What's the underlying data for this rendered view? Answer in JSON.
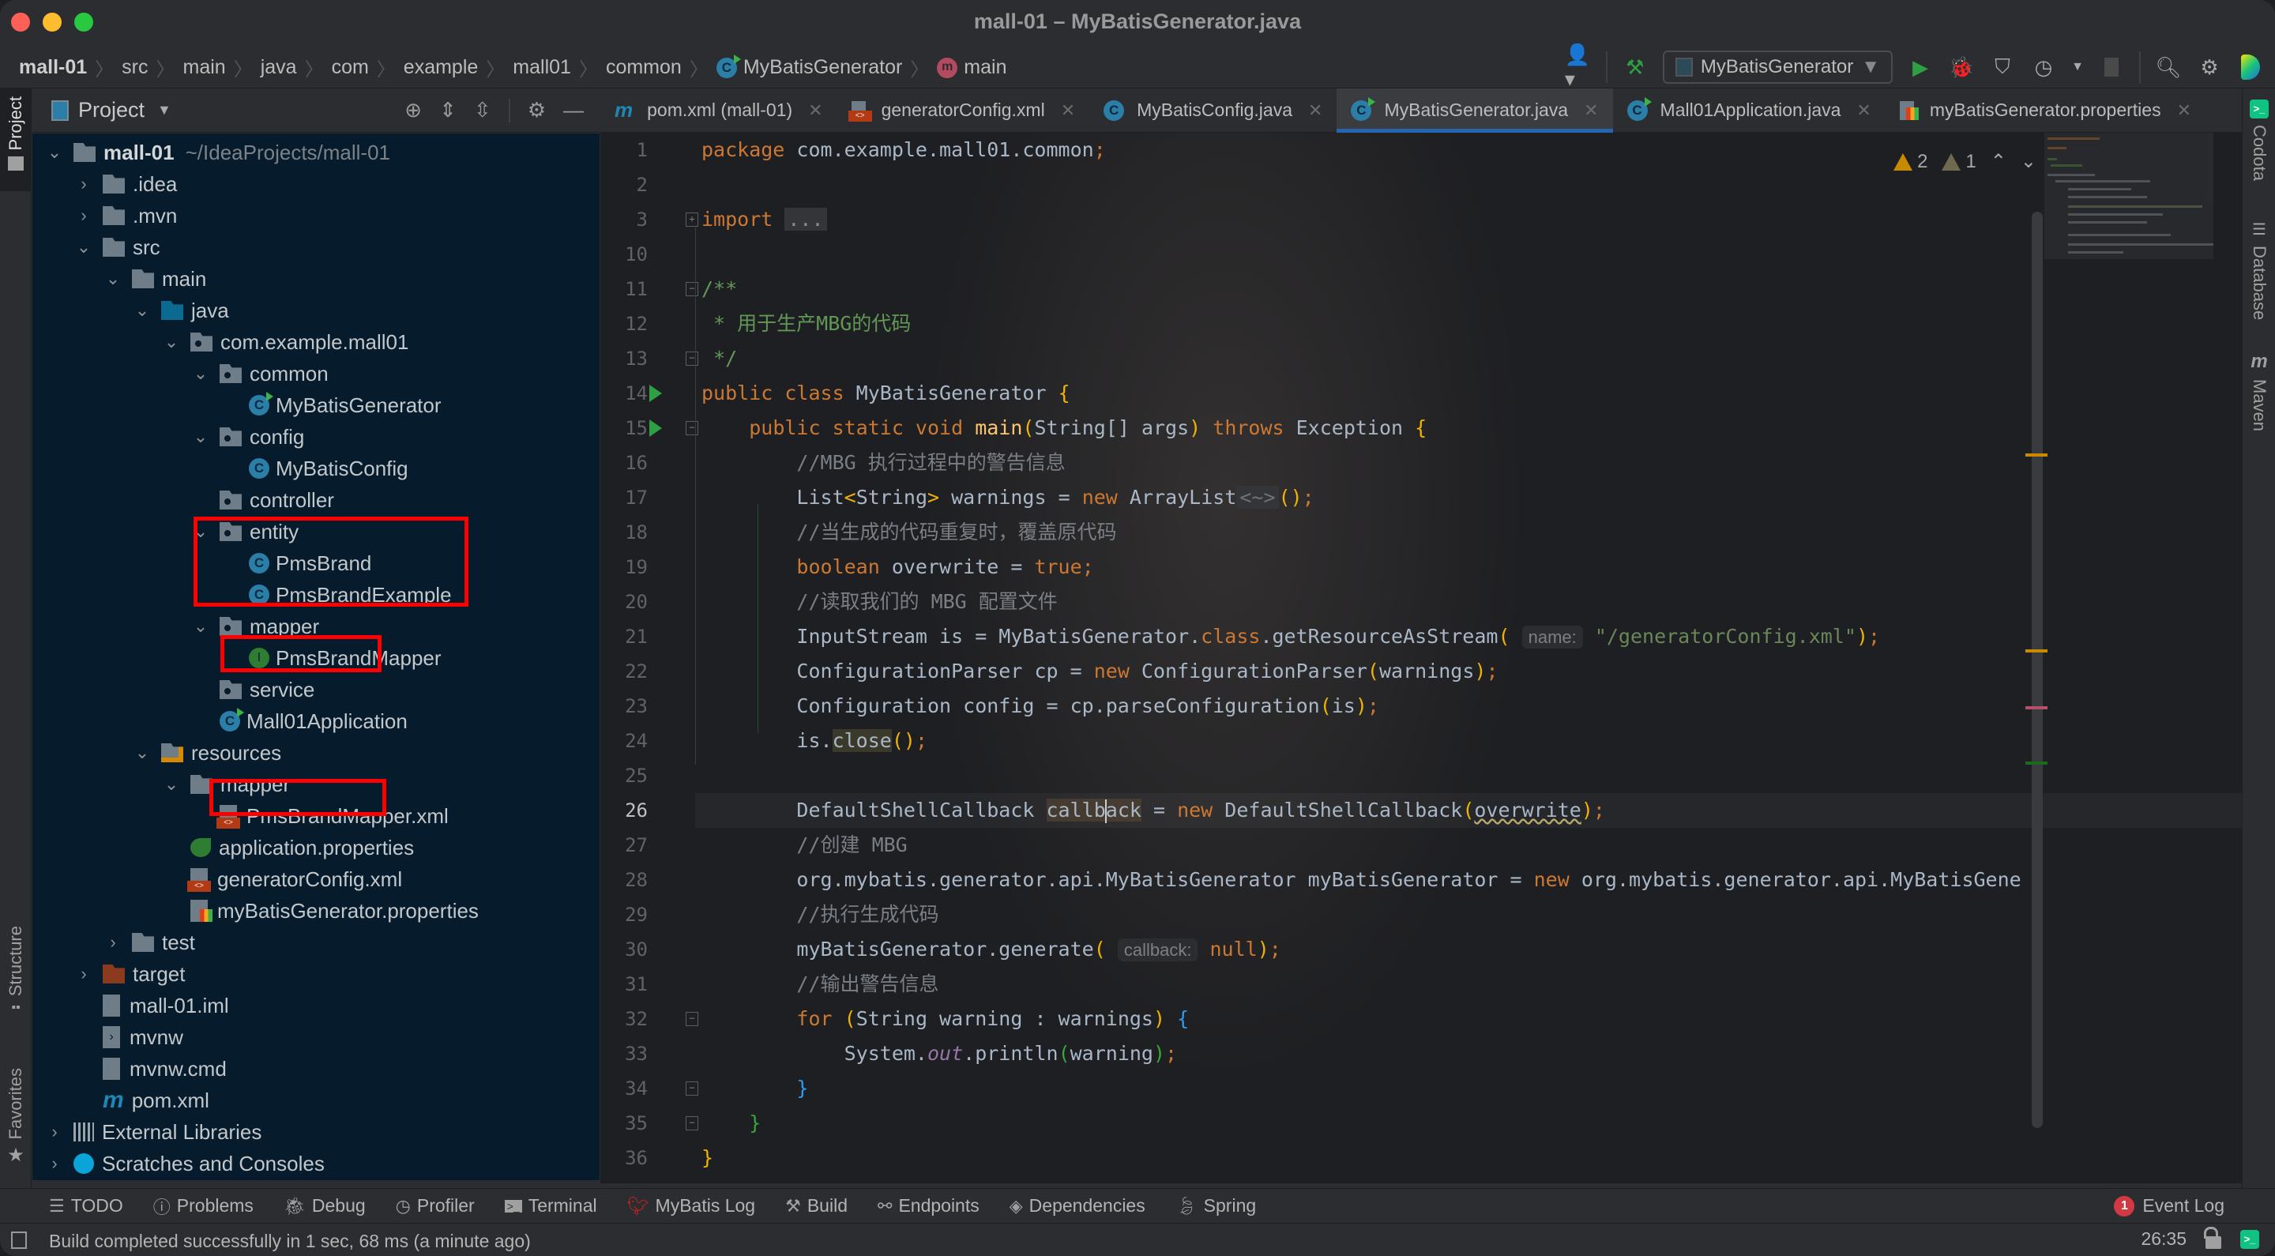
{
  "window": {
    "title": "mall-01 – MyBatisGenerator.java"
  },
  "breadcrumbs": [
    {
      "label": "mall-01",
      "icon": "none"
    },
    {
      "label": "src",
      "icon": "none"
    },
    {
      "label": "main",
      "icon": "none"
    },
    {
      "label": "java",
      "icon": "none"
    },
    {
      "label": "com",
      "icon": "none"
    },
    {
      "label": "example",
      "icon": "none"
    },
    {
      "label": "mall01",
      "icon": "none"
    },
    {
      "label": "common",
      "icon": "none"
    },
    {
      "label": "MyBatisGenerator",
      "icon": "class-icon"
    },
    {
      "label": "main",
      "icon": "method-icon"
    }
  ],
  "toolbar": {
    "run_config_label": "MyBatisGenerator",
    "icons": [
      "vcs-user-icon",
      "build-hammer-icon",
      "run-icon",
      "debug-icon",
      "coverage-icon",
      "profile-icon",
      "stop-icon",
      "search-icon",
      "settings-gear-icon",
      "jetbrains-logo-icon"
    ]
  },
  "left_stripe": {
    "project_label": "Project",
    "structure_label": "Structure",
    "favorites_label": "Favorites"
  },
  "project_panel": {
    "title": "Project",
    "tools": [
      "locate-icon",
      "expand-all-icon",
      "collapse-all-icon",
      "gear-icon",
      "hide-icon"
    ],
    "tree": [
      {
        "label": "mall-01",
        "path": "~/IdeaProjects/mall-01",
        "depth": 0,
        "state": "expanded",
        "icon": "module",
        "bold": true
      },
      {
        "label": ".idea",
        "depth": 1,
        "state": "collapsed",
        "icon": "folder"
      },
      {
        "label": ".mvn",
        "depth": 1,
        "state": "collapsed",
        "icon": "folder"
      },
      {
        "label": "src",
        "depth": 1,
        "state": "expanded",
        "icon": "folder"
      },
      {
        "label": "main",
        "depth": 2,
        "state": "expanded",
        "icon": "folder"
      },
      {
        "label": "java",
        "depth": 3,
        "state": "expanded",
        "icon": "source-folder"
      },
      {
        "label": "com.example.mall01",
        "depth": 4,
        "state": "expanded",
        "icon": "package"
      },
      {
        "label": "common",
        "depth": 5,
        "state": "expanded",
        "icon": "package"
      },
      {
        "label": "MyBatisGenerator",
        "depth": 6,
        "state": "leaf",
        "icon": "runnable-class"
      },
      {
        "label": "config",
        "depth": 5,
        "state": "expanded",
        "icon": "package"
      },
      {
        "label": "MyBatisConfig",
        "depth": 6,
        "state": "leaf",
        "icon": "class"
      },
      {
        "label": "controller",
        "depth": 5,
        "state": "leaf",
        "icon": "package"
      },
      {
        "label": "entity",
        "depth": 5,
        "state": "expanded",
        "icon": "package"
      },
      {
        "label": "PmsBrand",
        "depth": 6,
        "state": "leaf",
        "icon": "class"
      },
      {
        "label": "PmsBrandExample",
        "depth": 6,
        "state": "leaf",
        "icon": "class"
      },
      {
        "label": "mapper",
        "depth": 5,
        "state": "expanded",
        "icon": "package"
      },
      {
        "label": "PmsBrandMapper",
        "depth": 6,
        "state": "leaf",
        "icon": "interface"
      },
      {
        "label": "service",
        "depth": 5,
        "state": "leaf",
        "icon": "package"
      },
      {
        "label": "Mall01Application",
        "depth": 5,
        "state": "leaf",
        "icon": "spring-boot-class"
      },
      {
        "label": "resources",
        "depth": 3,
        "state": "expanded",
        "icon": "resources-folder"
      },
      {
        "label": "mapper",
        "depth": 4,
        "state": "expanded",
        "icon": "folder"
      },
      {
        "label": "PmsBrandMapper.xml",
        "depth": 5,
        "state": "leaf",
        "icon": "xml"
      },
      {
        "label": "application.properties",
        "depth": 4,
        "state": "leaf",
        "icon": "spring-properties"
      },
      {
        "label": "generatorConfig.xml",
        "depth": 4,
        "state": "leaf",
        "icon": "xml"
      },
      {
        "label": "myBatisGenerator.properties",
        "depth": 4,
        "state": "leaf",
        "icon": "properties"
      },
      {
        "label": "test",
        "depth": 2,
        "state": "collapsed",
        "icon": "folder"
      },
      {
        "label": "target",
        "depth": 1,
        "state": "collapsed",
        "icon": "excluded-folder"
      },
      {
        "label": "mall-01.iml",
        "depth": 1,
        "state": "leaf",
        "icon": "iml"
      },
      {
        "label": "mvnw",
        "depth": 1,
        "state": "leaf",
        "icon": "shell"
      },
      {
        "label": "mvnw.cmd",
        "depth": 1,
        "state": "leaf",
        "icon": "text"
      },
      {
        "label": "pom.xml",
        "depth": 1,
        "state": "leaf",
        "icon": "maven"
      },
      {
        "label": "External Libraries",
        "depth": 0,
        "state": "collapsed",
        "icon": "libraries"
      },
      {
        "label": "Scratches and Consoles",
        "depth": 0,
        "state": "collapsed",
        "icon": "scratches"
      }
    ],
    "highlight_annotations": [
      "entity group (PmsBrand, PmsBrandExample)",
      "PmsBrandMapper",
      "PmsBrandMapper.xml"
    ]
  },
  "editor_tabs": [
    {
      "label": "pom.xml (mall-01)",
      "icon": "maven-icon",
      "active": false
    },
    {
      "label": "generatorConfig.xml",
      "icon": "xml-file-icon",
      "active": false
    },
    {
      "label": "MyBatisConfig.java",
      "icon": "class-icon",
      "active": false
    },
    {
      "label": "MyBatisGenerator.java",
      "icon": "runnable-class-icon",
      "active": true
    },
    {
      "label": "Mall01Application.java",
      "icon": "spring-boot-class-icon",
      "active": false
    },
    {
      "label": "myBatisGenerator.properties",
      "icon": "properties-file-icon",
      "active": false
    }
  ],
  "inspections": {
    "warnings": "2",
    "weak_warnings": "1"
  },
  "code": {
    "current_line": 26,
    "lines": [
      {
        "n": "1"
      },
      {
        "n": "2"
      },
      {
        "n": "3"
      },
      {
        "n": "10"
      },
      {
        "n": "11"
      },
      {
        "n": "12"
      },
      {
        "n": "13"
      },
      {
        "n": "14"
      },
      {
        "n": "15"
      },
      {
        "n": "16"
      },
      {
        "n": "17"
      },
      {
        "n": "18"
      },
      {
        "n": "19"
      },
      {
        "n": "20"
      },
      {
        "n": "21"
      },
      {
        "n": "22"
      },
      {
        "n": "23"
      },
      {
        "n": "24"
      },
      {
        "n": "25"
      },
      {
        "n": "26"
      },
      {
        "n": "27"
      },
      {
        "n": "28"
      },
      {
        "n": "29"
      },
      {
        "n": "30"
      },
      {
        "n": "31"
      },
      {
        "n": "32"
      },
      {
        "n": "33"
      },
      {
        "n": "34"
      },
      {
        "n": "35"
      },
      {
        "n": "36"
      }
    ],
    "tokens": {
      "l1": {
        "kw": "package",
        "rest": " com.example.mall01.common",
        "semi": ";"
      },
      "l3": {
        "kw": "import",
        "folded": "..."
      },
      "l11": "/**",
      "l12": " * 用于生产MBG的代码",
      "l13": " */",
      "l14": {
        "kw": "public class",
        "name": " MyBatisGenerator ",
        "brace": "{"
      },
      "l15": {
        "kw": "public static void",
        "method": " main",
        "p1": "(",
        "sig": "String[] args",
        "p2": ")",
        "kw2": " throws",
        "rest": " Exception ",
        "brace": "{"
      },
      "l16": "//MBG 执行过程中的警告信息",
      "l17": {
        "a": "List",
        "lt": "<",
        "b": "String",
        "gt": ">",
        "c": " warnings = ",
        "kw": "new",
        "d": " ArrayList",
        "diamond": "<~>",
        "p": "()",
        "semi": ";"
      },
      "l18": "//当生成的代码重复时，覆盖原代码",
      "l19": {
        "kw": "boolean",
        "a": " overwrite = ",
        "kw2": "true",
        "semi": ";"
      },
      "l20": "//读取我们的 MBG 配置文件",
      "l21": {
        "a": "InputStream is = MyBatisGenerator.",
        "kw": "class",
        "b": ".getResourceAsStream",
        "p1": "(",
        "hint": "name:",
        "str": "\"/generatorConfig.xml\"",
        "p2": ")",
        "semi": ";"
      },
      "l22": {
        "a": "ConfigurationParser cp = ",
        "kw": "new",
        "b": " ConfigurationParser",
        "p1": "(",
        "arg": "warnings",
        "p2": ")",
        "semi": ";"
      },
      "l23": {
        "a": "Configuration config = cp.parseConfiguration",
        "p1": "(",
        "arg": "is",
        "p2": ")",
        "semi": ";"
      },
      "l24": {
        "a": "is.",
        "b": "close",
        "p": "()",
        "semi": ";"
      },
      "l26": {
        "a": "DefaultShellCallback ",
        "b1": "callb",
        "b2": "ack",
        "c": " = ",
        "kw": "new",
        "d": " DefaultShellCallback",
        "p1": "(",
        "arg": "overwrite",
        "p2": ")",
        "semi": ";"
      },
      "l27": "//创建 MBG",
      "l28": {
        "a": "org.mybatis.generator.api.MyBatisGenerator myBatisGenerator = ",
        "kw": "new",
        "b": " org.mybatis.generator.api.MyBatisGene"
      },
      "l29": "//执行生成代码",
      "l30": {
        "a": "myBatisGenerator.generate",
        "p1": "(",
        "hint": "callback:",
        "kw": "null",
        "p2": ")",
        "semi": ";"
      },
      "l31": "//输出警告信息",
      "l32": {
        "kw": "for",
        "p1": " (",
        "a": "String warning : warnings",
        "p2": ")",
        "brace": " {"
      },
      "l33": {
        "a": "System.",
        "field": "out",
        "b": ".println",
        "p1": "(",
        "arg": "warning",
        "p2": ")",
        "semi": ";"
      },
      "l34": "}",
      "l35": "}",
      "l36": "}"
    }
  },
  "right_stripe": {
    "items": [
      {
        "label": "Codota",
        "icon": "codota-icon"
      },
      {
        "label": "Database",
        "icon": "database-icon"
      },
      {
        "label": "Maven",
        "icon": "maven-icon"
      }
    ]
  },
  "bottom_tools": [
    {
      "label": "TODO",
      "icon": "todo-list-icon"
    },
    {
      "label": "Problems",
      "icon": "problems-icon"
    },
    {
      "label": "Debug",
      "icon": "bug-icon"
    },
    {
      "label": "Profiler",
      "icon": "profiler-icon"
    },
    {
      "label": "Terminal",
      "icon": "terminal-icon"
    },
    {
      "label": "MyBatis Log",
      "icon": "mybatis-log-icon"
    },
    {
      "label": "Build",
      "icon": "hammer-icon"
    },
    {
      "label": "Endpoints",
      "icon": "endpoints-icon"
    },
    {
      "label": "Dependencies",
      "icon": "dependencies-icon"
    },
    {
      "label": "Spring",
      "icon": "spring-leaf-icon"
    }
  ],
  "event_log": {
    "label": "Event Log",
    "count": "1"
  },
  "status_bar": {
    "message": "Build completed successfully in 1 sec, 68 ms (a minute ago)",
    "caret_position": "26:35"
  },
  "colors": {
    "accent_tab": "#2466b0",
    "highlight_box": "#ff0000",
    "run_green": "#2ea043",
    "warning": "#c88a00",
    "badge_red": "#d13a43"
  }
}
